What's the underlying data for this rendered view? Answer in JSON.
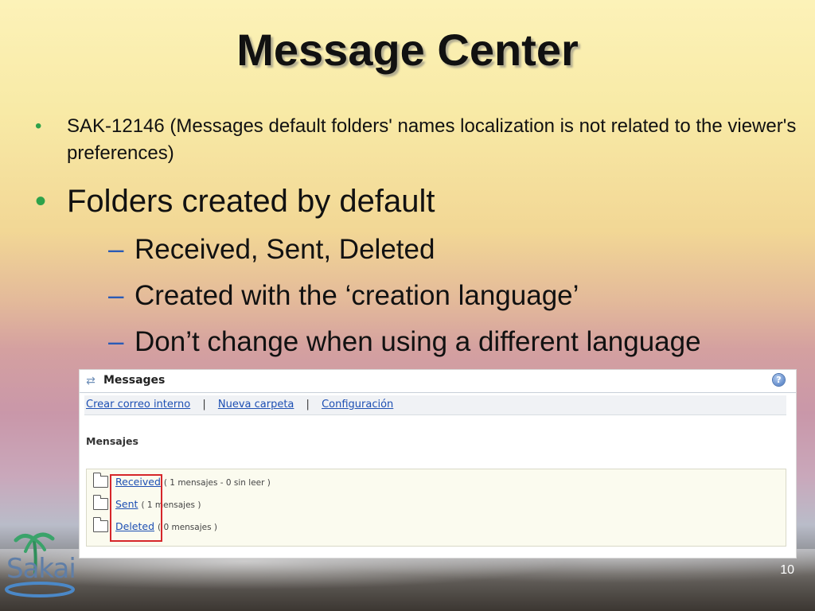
{
  "slide": {
    "title": "Message Center",
    "page_number": "10",
    "colors": {
      "bullet": "#2ea24a",
      "dash": "#2a5bb6",
      "highlight": "#d6262a",
      "link": "#1d4fb3"
    }
  },
  "bullets": {
    "item1": "SAK-12146 (Messages default folders' names localization is not related to the viewer's preferences)",
    "item2": "Folders created by default",
    "sub1": "Received, Sent, Deleted",
    "sub2": "Created with the ‘creation language’",
    "sub3": "Don’t change when using a different language",
    "bullet_glyph": "•",
    "dash_glyph": "–"
  },
  "screenshot": {
    "tool_icon": "swap-arrows-icon",
    "tool_title": "Messages",
    "help_icon": "help-icon",
    "help_glyph": "?",
    "toolbar": {
      "link1": "Crear correo interno",
      "link2": "Nueva carpeta",
      "link3": "Configuración",
      "separator": "|"
    },
    "section_label": "Mensajes",
    "folders": [
      {
        "name": "Received",
        "count": "( 1 mensajes - 0 sin leer )"
      },
      {
        "name": "Sent",
        "count": "( 1 mensajes )"
      },
      {
        "name": "Deleted",
        "count": "( 0 mensajes )"
      }
    ]
  },
  "logo": {
    "text": "Sakai",
    "icon": "palm-tree-icon"
  }
}
